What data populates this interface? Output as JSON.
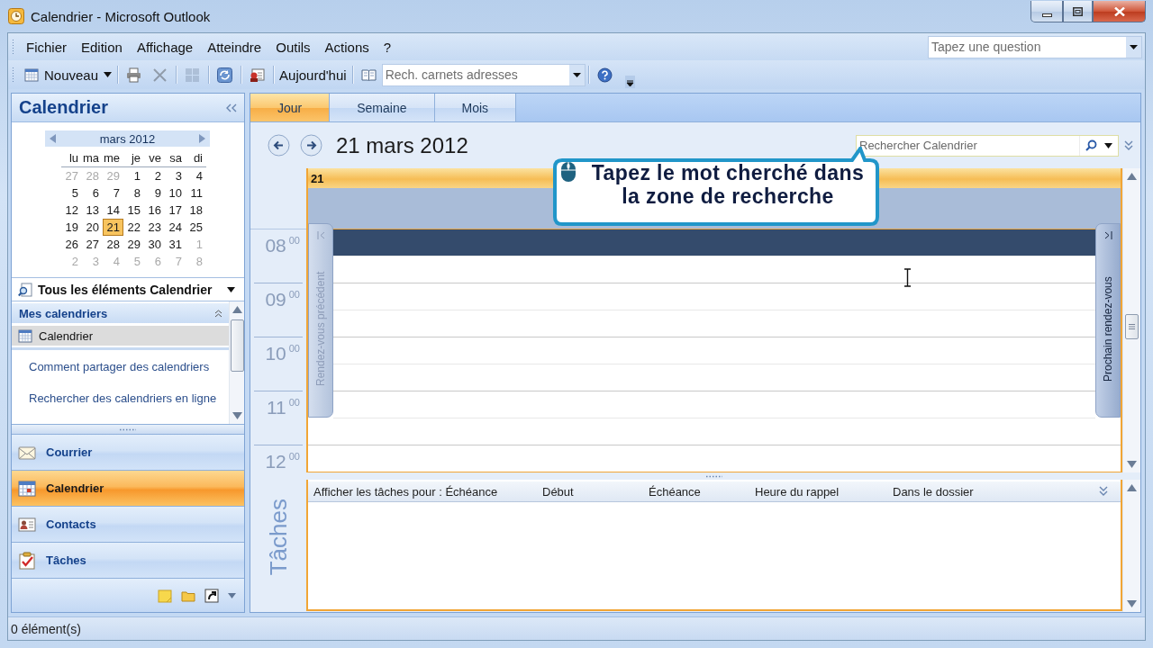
{
  "window": {
    "title": "Calendrier - Microsoft Outlook"
  },
  "menu_bar": {
    "items": [
      {
        "label": "Fichier"
      },
      {
        "label": "Edition"
      },
      {
        "label": "Affichage"
      },
      {
        "label": "Atteindre"
      },
      {
        "label": "Outils"
      },
      {
        "label": "Actions"
      },
      {
        "label": "?"
      }
    ],
    "question_box": {
      "placeholder": "Tapez une question"
    }
  },
  "toolbar": {
    "items": [
      {
        "kind": "new",
        "label": "Nouveau"
      },
      {
        "kind": "separator"
      },
      {
        "kind": "print",
        "disabled": false
      },
      {
        "kind": "delete",
        "disabled": true
      },
      {
        "kind": "separator"
      },
      {
        "kind": "grid",
        "disabled": true
      },
      {
        "kind": "separator"
      },
      {
        "kind": "sync",
        "disabled": false
      },
      {
        "kind": "separator"
      },
      {
        "kind": "card",
        "disabled": false
      },
      {
        "kind": "separator"
      },
      {
        "kind": "today",
        "label": "Aujourd'hui"
      },
      {
        "kind": "separator"
      },
      {
        "kind": "book",
        "disabled": false
      },
      {
        "kind": "address_search",
        "placeholder": "Rech. carnets adresses"
      },
      {
        "kind": "separator"
      },
      {
        "kind": "help",
        "disabled": false
      }
    ]
  },
  "navigation_pane": {
    "title": "Calendrier",
    "date_navigator": {
      "month": "mars 2012",
      "weekdays": [
        "lu",
        "ma",
        "me",
        "je",
        "ve",
        "sa",
        "di"
      ],
      "weeks": [
        [
          {
            "day": "27",
            "other_month": true,
            "selected": false
          },
          {
            "day": "28",
            "other_month": true,
            "selected": false
          },
          {
            "day": "29",
            "other_month": true,
            "selected": false
          },
          {
            "day": "1",
            "other_month": false,
            "selected": false
          },
          {
            "day": "2",
            "other_month": false,
            "selected": false
          },
          {
            "day": "3",
            "other_month": false,
            "selected": false
          },
          {
            "day": "4",
            "other_month": false,
            "selected": false
          }
        ],
        [
          {
            "day": "5",
            "other_month": false,
            "selected": false
          },
          {
            "day": "6",
            "other_month": false,
            "selected": false
          },
          {
            "day": "7",
            "other_month": false,
            "selected": false
          },
          {
            "day": "8",
            "other_month": false,
            "selected": false
          },
          {
            "day": "9",
            "other_month": false,
            "selected": false
          },
          {
            "day": "10",
            "other_month": false,
            "selected": false
          },
          {
            "day": "11",
            "other_month": false,
            "selected": false
          }
        ],
        [
          {
            "day": "12",
            "other_month": false,
            "selected": false
          },
          {
            "day": "13",
            "other_month": false,
            "selected": false
          },
          {
            "day": "14",
            "other_month": false,
            "selected": false
          },
          {
            "day": "15",
            "other_month": false,
            "selected": false
          },
          {
            "day": "16",
            "other_month": false,
            "selected": false
          },
          {
            "day": "17",
            "other_month": false,
            "selected": false
          },
          {
            "day": "18",
            "other_month": false,
            "selected": false
          }
        ],
        [
          {
            "day": "19",
            "other_month": false,
            "selected": false
          },
          {
            "day": "20",
            "other_month": false,
            "selected": false
          },
          {
            "day": "21",
            "other_month": false,
            "selected": true
          },
          {
            "day": "22",
            "other_month": false,
            "selected": false
          },
          {
            "day": "23",
            "other_month": false,
            "selected": false
          },
          {
            "day": "24",
            "other_month": false,
            "selected": false
          },
          {
            "day": "25",
            "other_month": false,
            "selected": false
          }
        ],
        [
          {
            "day": "26",
            "other_month": false,
            "selected": false
          },
          {
            "day": "27",
            "other_month": false,
            "selected": false
          },
          {
            "day": "28",
            "other_month": false,
            "selected": false
          },
          {
            "day": "29",
            "other_month": false,
            "selected": false
          },
          {
            "day": "30",
            "other_month": false,
            "selected": false
          },
          {
            "day": "31",
            "other_month": false,
            "selected": false
          },
          {
            "day": "1",
            "other_month": true,
            "selected": false
          }
        ],
        [
          {
            "day": "2",
            "other_month": true,
            "selected": false
          },
          {
            "day": "3",
            "other_month": true,
            "selected": false
          },
          {
            "day": "4",
            "other_month": true,
            "selected": false
          },
          {
            "day": "5",
            "other_month": true,
            "selected": false
          },
          {
            "day": "6",
            "other_month": true,
            "selected": false
          },
          {
            "day": "7",
            "other_month": true,
            "selected": false
          },
          {
            "day": "8",
            "other_month": true,
            "selected": false
          }
        ]
      ]
    },
    "view_filter": {
      "label": "Tous les éléments Calendrier"
    },
    "my_calendars": {
      "title": "Mes calendriers",
      "items": [
        {
          "label": "Calendrier",
          "selected": true
        }
      ]
    },
    "links": [
      "Comment partager des calendriers",
      "Rechercher des calendriers en ligne"
    ],
    "buttons": [
      {
        "kind": "mail",
        "label": "Courrier",
        "selected": false
      },
      {
        "kind": "calendar",
        "label": "Calendrier",
        "selected": true
      },
      {
        "kind": "contacts",
        "label": "Contacts",
        "selected": false
      },
      {
        "kind": "tasks",
        "label": "Tâches",
        "selected": false
      }
    ]
  },
  "calendar_view": {
    "tabs": [
      {
        "label": "Jour",
        "selected": true
      },
      {
        "label": "Semaine",
        "selected": false
      },
      {
        "label": "Mois",
        "selected": false
      }
    ],
    "date_title": "21 mars 2012",
    "search": {
      "placeholder": "Rechercher Calendrier"
    },
    "day_header": "21",
    "hours": [
      {
        "hour": "08",
        "minutes": "00"
      },
      {
        "hour": "09",
        "minutes": "00"
      },
      {
        "hour": "10",
        "minutes": "00"
      },
      {
        "hour": "11",
        "minutes": "00"
      },
      {
        "hour": "12",
        "minutes": "00"
      }
    ],
    "slots": [
      {
        "selected": true
      },
      {
        "selected": false
      },
      {
        "selected": false
      },
      {
        "selected": false
      },
      {
        "selected": false
      },
      {
        "selected": false
      },
      {
        "selected": false
      },
      {
        "selected": false
      }
    ],
    "previous_tab": {
      "label": "Rendez-vous précédent",
      "disabled": true
    },
    "next_tab": {
      "label": "Prochain rendez-vous",
      "disabled": false
    }
  },
  "tasks": {
    "title": "Tâches",
    "columns": [
      "Afficher les tâches pour : Échéance",
      "Début",
      "Échéance",
      "Heure du rappel",
      "Dans le dossier"
    ]
  },
  "callout": {
    "text": "Tapez le mot cherché dans\nla zone de recherche"
  },
  "status_bar": {
    "text": "0 élément(s)"
  }
}
